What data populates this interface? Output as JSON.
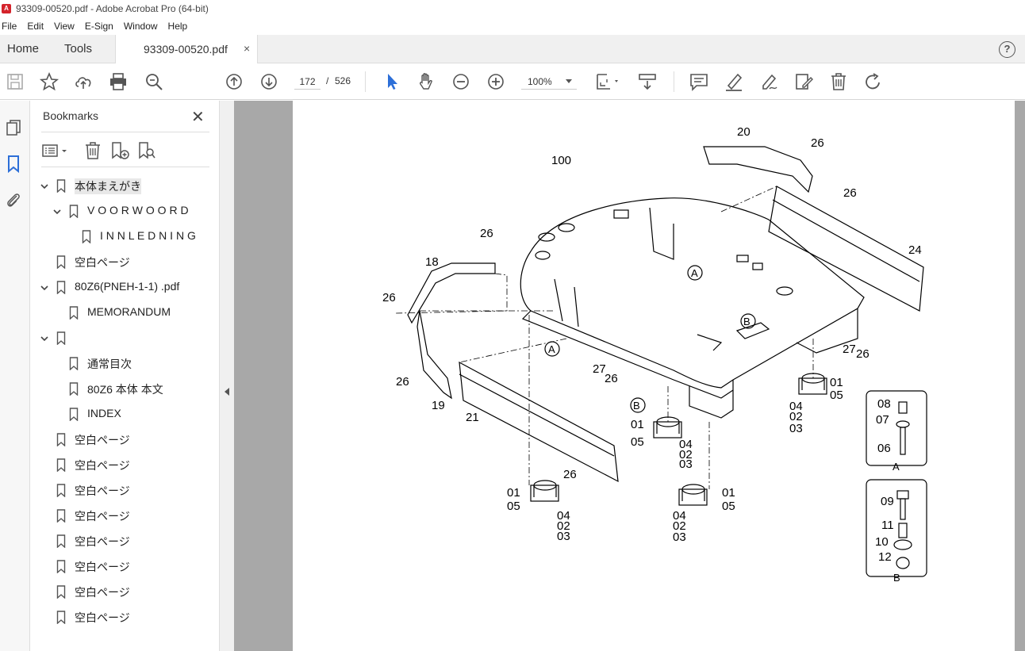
{
  "window": {
    "title": "93309-00520.pdf - Adobe Acrobat Pro (64-bit)"
  },
  "menu": [
    "File",
    "Edit",
    "View",
    "E-Sign",
    "Window",
    "Help"
  ],
  "tabs": {
    "home": "Home",
    "tools": "Tools",
    "document": "93309-00520.pdf",
    "close": "×"
  },
  "toolbar": {
    "current_page": "172",
    "page_separator": "/",
    "total_pages": "526",
    "zoom": "100%"
  },
  "bookmarks_panel": {
    "title": "Bookmarks",
    "close": "✕",
    "items": [
      {
        "label": "本体まえがき",
        "level": 0,
        "expanded": true,
        "selected": true
      },
      {
        "label": "V O O R W O O R D",
        "level": 1,
        "expanded": true
      },
      {
        "label": "I N N L E D N I N G",
        "level": 2
      },
      {
        "label": "空白ページ",
        "level": 0
      },
      {
        "label": "80Z6(PNEH-1-1) .pdf",
        "level": 0,
        "expanded": true
      },
      {
        "label": "MEMORANDUM",
        "level": 1
      },
      {
        "label": "",
        "level": 0,
        "expanded": true
      },
      {
        "label": "通常目次",
        "level": 1
      },
      {
        "label": "80Z6 本体 本文",
        "level": 1
      },
      {
        "label": "INDEX",
        "level": 1
      },
      {
        "label": "空白ページ",
        "level": 0
      },
      {
        "label": "空白ページ",
        "level": 0
      },
      {
        "label": "空白ページ",
        "level": 0
      },
      {
        "label": "空白ページ",
        "level": 0
      },
      {
        "label": "空白ページ",
        "level": 0
      },
      {
        "label": "空白ページ",
        "level": 0
      },
      {
        "label": "空白ページ",
        "level": 0
      },
      {
        "label": "空白ページ",
        "level": 0
      }
    ]
  },
  "drawing": {
    "callouts": {
      "c100": "100",
      "c20": "20",
      "c26a": "26",
      "c26b": "26",
      "c24": "24",
      "c26c": "26",
      "c18": "18",
      "c26d": "26",
      "cA1": "A",
      "cB1": "B",
      "cA2": "A",
      "c27a": "27",
      "c26e": "26",
      "c27b": "27",
      "c26f": "26",
      "c26g": "26",
      "c19": "19",
      "c21": "21",
      "cB2": "B",
      "c01a": "01",
      "c05a": "05",
      "c04a": "04",
      "c02a": "02",
      "c03a": "03",
      "c01b": "01",
      "c05b": "05",
      "c04b": "04",
      "c02b": "02",
      "c03b": "03",
      "c26h": "26",
      "c01c": "01",
      "c05c": "05",
      "c04c": "04",
      "c02c": "02",
      "c03c": "03",
      "c01d": "01",
      "c05d": "05",
      "c04d": "04",
      "c02d": "02",
      "c03d": "03",
      "d08": "08",
      "d07": "07",
      "d06": "06",
      "dA": "A",
      "d09": "09",
      "d11": "11",
      "d10": "10",
      "d12": "12",
      "dB": "B"
    }
  },
  "colors": {
    "accent_blue": "#2d6fd8",
    "doc_background": "#a8a8a8"
  },
  "icons": {
    "toolbar": [
      "save-icon",
      "star-icon",
      "cloud-upload-icon",
      "print-icon",
      "zoom-search-icon",
      "arrow-up-icon",
      "arrow-down-icon",
      "select-cursor-icon",
      "hand-icon",
      "zoom-out-icon",
      "zoom-in-icon",
      "page-fit-icon",
      "scroll-mode-icon",
      "comment-icon",
      "highlight-icon",
      "sign-icon",
      "edit-icon",
      "trash-icon",
      "rotate-icon"
    ]
  }
}
